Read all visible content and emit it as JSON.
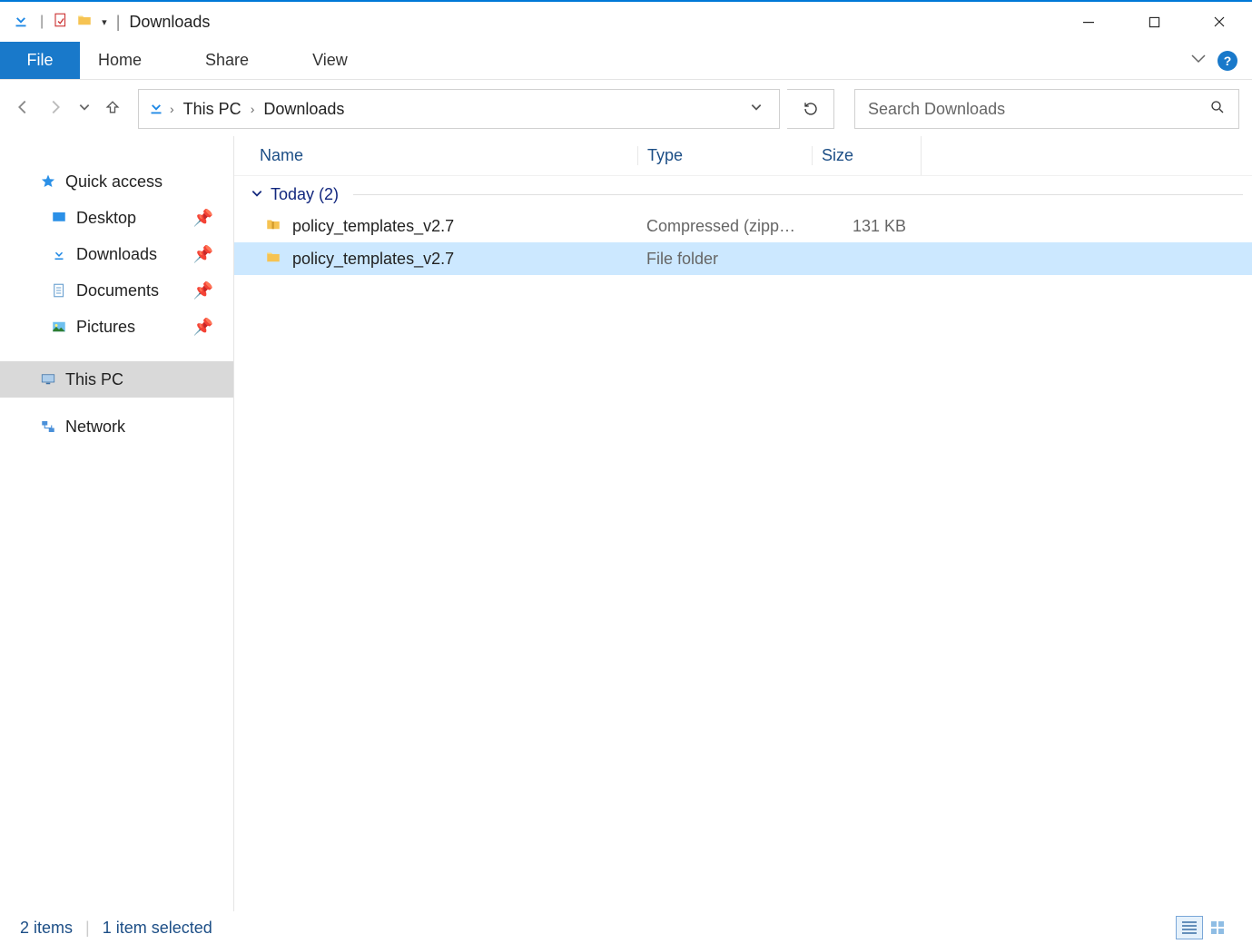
{
  "window": {
    "title": "Downloads"
  },
  "ribbon": {
    "file": "File",
    "tabs": [
      "Home",
      "Share",
      "View"
    ]
  },
  "breadcrumb": {
    "items": [
      "This PC",
      "Downloads"
    ]
  },
  "search": {
    "placeholder": "Search Downloads"
  },
  "sidebar": {
    "quick_access": {
      "label": "Quick access"
    },
    "items": [
      {
        "label": "Desktop",
        "pinned": true
      },
      {
        "label": "Downloads",
        "pinned": true
      },
      {
        "label": "Documents",
        "pinned": true
      },
      {
        "label": "Pictures",
        "pinned": true
      }
    ],
    "this_pc": {
      "label": "This PC"
    },
    "network": {
      "label": "Network"
    }
  },
  "columns": {
    "name": "Name",
    "type": "Type",
    "size": "Size"
  },
  "group": {
    "label": "Today (2)"
  },
  "files": [
    {
      "name": "policy_templates_v2.7",
      "type": "Compressed (zipp…",
      "size": "131 KB",
      "icon": "zip",
      "selected": false
    },
    {
      "name": "policy_templates_v2.7",
      "type": "File folder",
      "size": "",
      "icon": "folder",
      "selected": true
    }
  ],
  "status": {
    "count": "2 items",
    "selected": "1 item selected"
  }
}
